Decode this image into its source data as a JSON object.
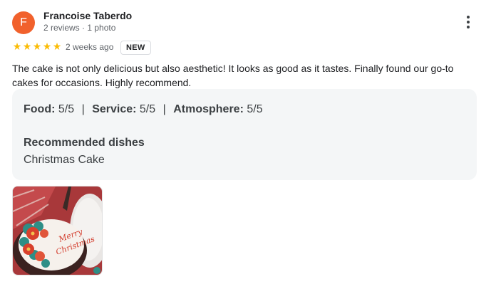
{
  "reviewer": {
    "initial": "F",
    "name": "Francoise Taberdo",
    "meta": "2 reviews · 1 photo",
    "avatar_color": "#f1612c"
  },
  "rating": {
    "stars": 5,
    "max": 5,
    "star_color": "#fbbc04"
  },
  "time_ago": "2 weeks ago",
  "badge": "NEW",
  "review_text": "The cake is not only delicious but also aesthetic! It looks as good as it tastes. Finally found our go-to cakes for occasions. Highly recommend.",
  "details": {
    "food_label": "Food:",
    "food_value": "5/5",
    "service_label": "Service:",
    "service_value": "5/5",
    "atmosphere_label": "Atmosphere:",
    "atmosphere_value": "5/5",
    "separator": "|",
    "recommended_title": "Recommended dishes",
    "recommended_dish": "Christmas Cake"
  },
  "photo": {
    "icon": "cake-photo",
    "cake_text_line1": "Merry",
    "cake_text_line2": "Christmas"
  },
  "more_icon": "more-vert-icon"
}
